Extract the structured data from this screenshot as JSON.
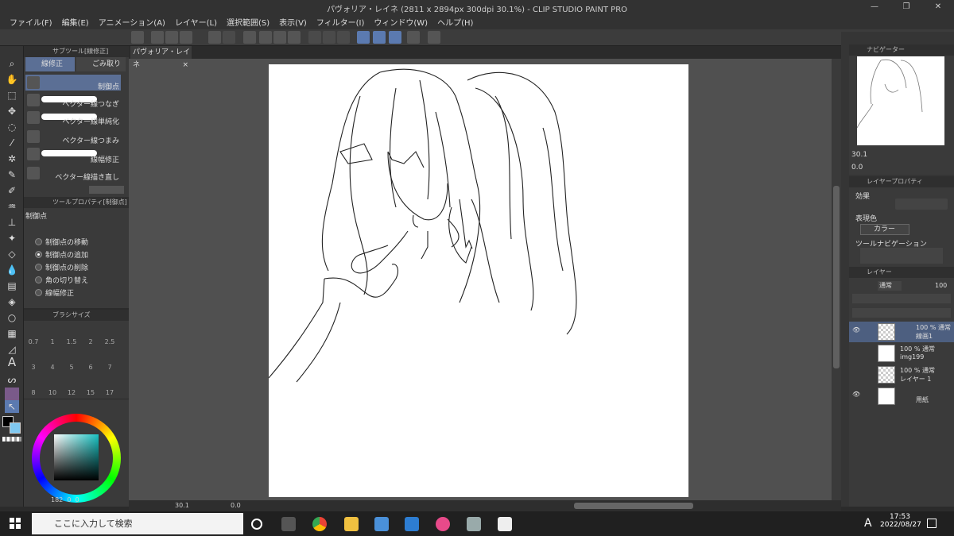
{
  "window": {
    "title": "パヴォリア・レイネ (2811 x 2894px 300dpi 30.1%)  - CLIP STUDIO PAINT PRO",
    "controls": [
      "—",
      "❐",
      "✕"
    ]
  },
  "menu": [
    "ファイル(F)",
    "編集(E)",
    "アニメーション(A)",
    "レイヤー(L)",
    "選択範囲(S)",
    "表示(V)",
    "フィルター(I)",
    "ウィンドウ(W)",
    "ヘルプ(H)"
  ],
  "subtool": {
    "header": "サブツール[線修正]",
    "tabs": [
      "線修正",
      "ごみ取り"
    ],
    "items": [
      "制御点",
      "ベクター線つなぎ",
      "ベクター線単純化",
      "ベクター線つまみ",
      "線幅修正",
      "ベクター線描き直し"
    ]
  },
  "toolprop": {
    "header": "ツールプロパティ[制御点]",
    "title": "制御点",
    "options": [
      "制御点の移動",
      "制御点の追加",
      "制御点の削除",
      "角の切り替え",
      "線幅修正"
    ],
    "selected_index": 1
  },
  "brushsize": {
    "header": "ブラシサイズ",
    "sizes": [
      "0.7",
      "1",
      "1.5",
      "2",
      "2.5",
      "3",
      "4",
      "5",
      "6",
      "7",
      "8",
      "10",
      "12",
      "15",
      "17"
    ]
  },
  "color": {
    "main": "#000000",
    "sub": "#7fc8f0",
    "status": [
      "182",
      "0",
      "0"
    ]
  },
  "canvas": {
    "tab_label": "パヴォリア・レイネ",
    "zoom": "30.1",
    "angle": "0.0"
  },
  "navigator": {
    "tab": "ナビゲーター",
    "zoom": "30.1",
    "angle": "0.0"
  },
  "layer_property": {
    "tab": "レイヤープロパティ",
    "effect_label": "効果",
    "expression_label": "表現色",
    "expression_value": "カラー",
    "tool_nav_label": "ツールナビゲーション"
  },
  "layers": {
    "tab": "レイヤー",
    "blend": "通常",
    "opacity": "100",
    "items": [
      {
        "opacity": "100 %",
        "mode": "通常",
        "name": "線画1",
        "visible": true,
        "selected": true
      },
      {
        "opacity": "100 %",
        "mode": "通常",
        "name": "img199",
        "visible": false,
        "selected": false
      },
      {
        "opacity": "100 %",
        "mode": "通常",
        "name": "レイヤー 1",
        "visible": false,
        "selected": false
      },
      {
        "opacity": "",
        "mode": "",
        "name": "用紙",
        "visible": true,
        "selected": false
      }
    ]
  },
  "taskbar": {
    "search_placeholder": "ここに入力して検索",
    "ime": "A",
    "time": "17:53",
    "date": "2022/08/27"
  }
}
